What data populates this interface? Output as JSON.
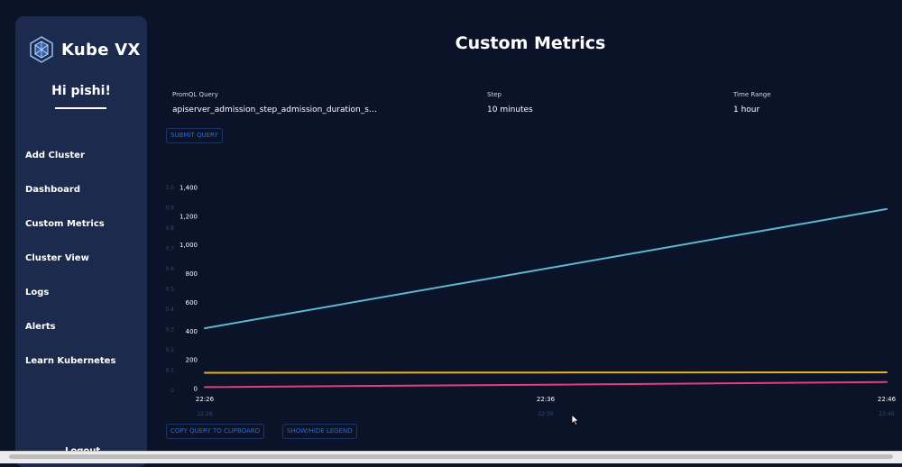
{
  "sidebar": {
    "brand": "Kube VX",
    "greeting": "Hi pishi!",
    "items": [
      {
        "label": "Add Cluster"
      },
      {
        "label": "Dashboard"
      },
      {
        "label": "Custom Metrics"
      },
      {
        "label": "Cluster View"
      },
      {
        "label": "Logs"
      },
      {
        "label": "Alerts"
      },
      {
        "label": "Learn Kubernetes"
      }
    ],
    "logout": "Logout"
  },
  "page_title": "Custom Metrics",
  "query_form": {
    "promql_label": "PromQL Query",
    "promql_value": "apiserver_admission_step_admission_duration_se…",
    "step_label": "Step",
    "step_value": "10 minutes",
    "range_label": "Time Range",
    "range_value": "1 hour",
    "submit_label": "SUBMIT QUERY"
  },
  "actions": {
    "copy_label": "COPY QUERY TO CLIPBOARD",
    "legend_label": "SHOW/HIDE LEGEND"
  },
  "colors": {
    "background": "#0b1329",
    "sidebar": "#1b2a4d",
    "accent_blue": "#2a6bd6",
    "series_1": "#5fb7cf",
    "series_2": "#e5b21f",
    "series_3": "#e0407a"
  },
  "chart_data": {
    "type": "line",
    "x": [
      "22:26",
      "22:36",
      "22:46"
    ],
    "x_ticks": [
      "22:26",
      "22:36",
      "22:46"
    ],
    "y_ticks": [
      "0",
      "200",
      "400",
      "600",
      "800",
      "1,000",
      "1,200",
      "1,400"
    ],
    "ylim": [
      0,
      1400
    ],
    "ghost_y_ticks": [
      "0",
      "0.1",
      "0.2",
      "0.3",
      "0.4",
      "0.5",
      "0.6",
      "0.7",
      "0.8",
      "0.9",
      "1.0"
    ],
    "ghost_x_ticks": [
      "22:26",
      "22:36",
      "22:46"
    ],
    "grid": false,
    "legend": "hidden",
    "series": [
      {
        "color": "#5fb7cf",
        "values": [
          420,
          835,
          1250
        ]
      },
      {
        "color": "#e5b21f",
        "values": [
          110,
          112,
          113
        ]
      },
      {
        "color": "#e0407a",
        "values": [
          10,
          27,
          45
        ]
      }
    ]
  }
}
